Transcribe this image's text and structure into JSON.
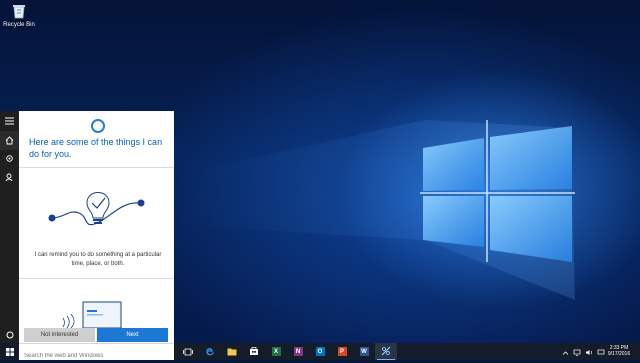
{
  "desktop": {
    "icons": [
      {
        "label": "Recycle Bin",
        "icon": "recycle-bin-icon"
      }
    ]
  },
  "start_rail": {
    "items": [
      {
        "name": "hamburger",
        "icon": "hamburger-menu-icon"
      },
      {
        "name": "home",
        "icon": "home-icon",
        "active": true
      },
      {
        "name": "notebook",
        "icon": "gear-icon"
      },
      {
        "name": "feedback",
        "icon": "feedback-icon"
      }
    ],
    "bottom_icon": "circle-icon"
  },
  "cortana": {
    "headline": "Here are some of the things I can do for you.",
    "remind_text": "I can remind you to do something at a particular time, place, or both.",
    "buttons": {
      "not_interested": "Not interested",
      "next": "Next"
    },
    "accent_color": "#1c78d4"
  },
  "taskbar": {
    "search_placeholder": "Search the web and Windows",
    "apps": [
      {
        "name": "task-view",
        "icon": "task-view-icon"
      },
      {
        "name": "edge",
        "icon": "edge-icon"
      },
      {
        "name": "file-explorer",
        "icon": "folder-icon"
      },
      {
        "name": "store",
        "icon": "store-icon"
      },
      {
        "name": "excel",
        "icon": "excel-icon",
        "letter": "X",
        "color": "#1e7145"
      },
      {
        "name": "onenote",
        "icon": "onenote-icon",
        "letter": "N",
        "color": "#80397b"
      },
      {
        "name": "outlook",
        "icon": "outlook-icon",
        "letter": "O",
        "color": "#0072c6"
      },
      {
        "name": "powerpoint",
        "icon": "powerpoint-icon",
        "letter": "P",
        "color": "#d24726"
      },
      {
        "name": "word",
        "icon": "word-icon",
        "letter": "W",
        "color": "#2b579a"
      },
      {
        "name": "snipping",
        "icon": "snipping-tool-icon",
        "active": true
      }
    ],
    "clock": {
      "time": "2:33 PM",
      "date": "9/17/2016"
    }
  }
}
